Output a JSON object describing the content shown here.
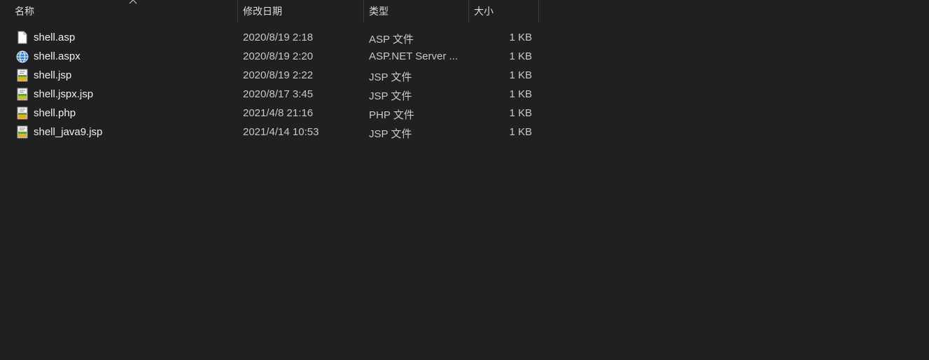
{
  "columns": {
    "name": "名称",
    "date": "修改日期",
    "type": "类型",
    "size": "大小"
  },
  "sort": {
    "column": "name",
    "direction": "ascending"
  },
  "files": [
    {
      "name": "shell.asp",
      "date": "2020/8/19 2:18",
      "type": "ASP 文件",
      "size": "1 KB",
      "icon": "blank-document-icon"
    },
    {
      "name": "shell.aspx",
      "date": "2020/8/19 2:20",
      "type": "ASP.NET Server ...",
      "size": "1 KB",
      "icon": "globe-document-icon"
    },
    {
      "name": "shell.jsp",
      "date": "2020/8/19 2:22",
      "type": "JSP 文件",
      "size": "1 KB",
      "icon": "jsp-document-icon"
    },
    {
      "name": "shell.jspx.jsp",
      "date": "2020/8/17 3:45",
      "type": "JSP 文件",
      "size": "1 KB",
      "icon": "jsp-document-icon"
    },
    {
      "name": "shell.php",
      "date": "2021/4/8 21:16",
      "type": "PHP 文件",
      "size": "1 KB",
      "icon": "php-document-icon"
    },
    {
      "name": "shell_java9.jsp",
      "date": "2021/4/14 10:53",
      "type": "JSP 文件",
      "size": "1 KB",
      "icon": "jsp-document-icon"
    }
  ],
  "colors": {
    "background": "#202020",
    "header_divider": "#3b3b3b",
    "text_primary": "#f2f2f2",
    "text_secondary": "#c8c8c8"
  }
}
